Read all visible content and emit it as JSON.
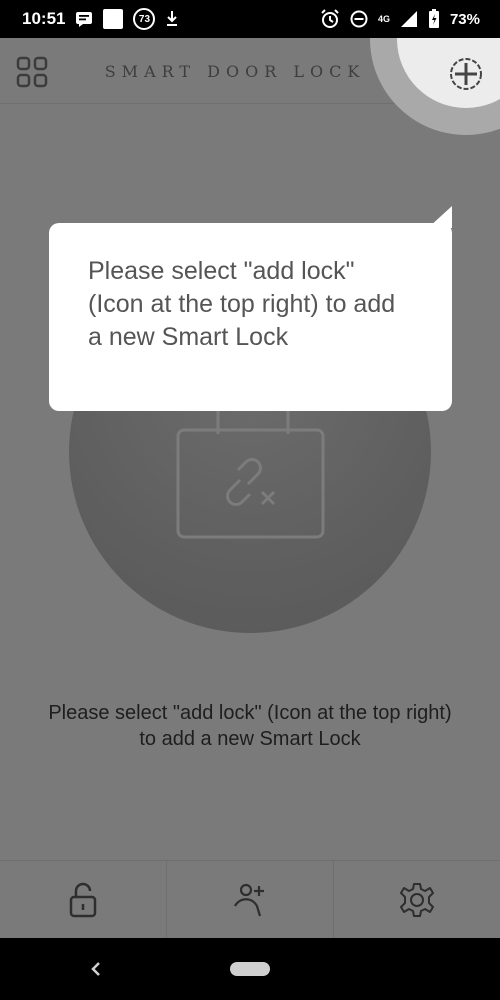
{
  "status_bar": {
    "time": "10:51",
    "notification_count": "73",
    "network": "4G",
    "battery": "73%"
  },
  "header": {
    "title": "SMART DOOR LOCK",
    "menu_icon": "grid-icon",
    "add_icon": "plus-circle-icon"
  },
  "tooltip": {
    "text": "Please select \"add lock\" (Icon at the top right) to add a new Smart Lock"
  },
  "main": {
    "empty_icon": "unlinked-lock-icon",
    "hint": "Please select \"add lock\" (Icon at the top right) to add a new Smart Lock"
  },
  "tabbar": {
    "items": [
      {
        "icon": "padlock-icon"
      },
      {
        "icon": "add-user-icon"
      },
      {
        "icon": "gear-icon"
      }
    ]
  },
  "colors": {
    "overlay": "#7a7a7a",
    "tooltip_bg": "#ffffff",
    "spotlight": "#ececec"
  }
}
